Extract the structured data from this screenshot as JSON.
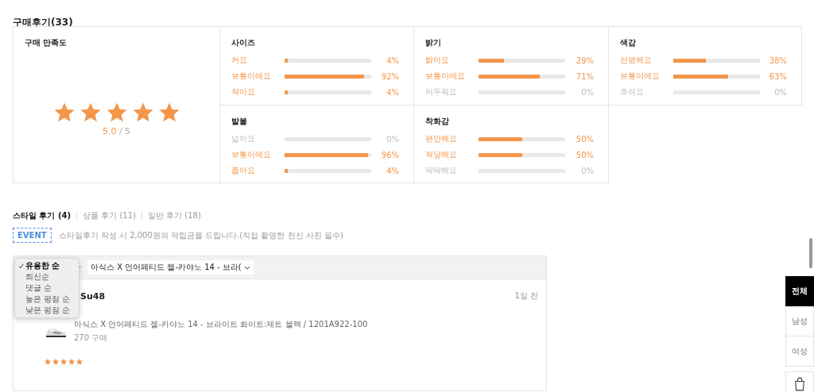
{
  "title": "구매후기(33)",
  "satisfaction": {
    "heading": "구매 만족도",
    "stars": 5,
    "score": "5.0",
    "max": "/ 5"
  },
  "metrics": [
    {
      "heading": "사이즈",
      "options": [
        {
          "label": "커요",
          "level": 0.04,
          "reading": "4%"
        },
        {
          "label": "보통이에요",
          "level": 0.92,
          "reading": "92%"
        },
        {
          "label": "작아요",
          "level": 0.04,
          "reading": "4%"
        }
      ]
    },
    {
      "heading": "밝기",
      "options": [
        {
          "label": "밝아요",
          "level": 0.29,
          "reading": "29%"
        },
        {
          "label": "보통이에요",
          "level": 0.71,
          "reading": "71%"
        },
        {
          "label": "어두워요",
          "level": 0,
          "reading": "0%"
        }
      ]
    },
    {
      "heading": "색감",
      "options": [
        {
          "label": "선명해요",
          "level": 0.38,
          "reading": "38%"
        },
        {
          "label": "보통이에요",
          "level": 0.63,
          "reading": "63%"
        },
        {
          "label": "흐려요",
          "level": 0,
          "reading": "0%"
        }
      ]
    },
    {
      "heading": "발볼",
      "options": [
        {
          "label": "넓어요",
          "level": 0,
          "reading": "0%"
        },
        {
          "label": "보통이에요",
          "level": 0.96,
          "reading": "96%"
        },
        {
          "label": "좁아요",
          "level": 0.04,
          "reading": "4%"
        }
      ]
    },
    {
      "heading": "착화감",
      "options": [
        {
          "label": "편안해요",
          "level": 0.5,
          "reading": "50%"
        },
        {
          "label": "적당해요",
          "level": 0.5,
          "reading": "50%"
        },
        {
          "label": "딱딱해요",
          "level": 0,
          "reading": "0%"
        }
      ]
    }
  ],
  "review_tabs": [
    {
      "label": "스타일 후기 (4)",
      "selected": true
    },
    {
      "label": "상품 후기 (11)",
      "selected": false
    },
    {
      "label": "일반 후기 (18)",
      "selected": false
    }
  ],
  "event": {
    "badge": "EVENT",
    "text": "스타일후기 작성 시 2,000원의 적립금을 드립니다.(직접 촬영한 전신 사진 필수)"
  },
  "sort_menu": [
    {
      "label": "유용한 순",
      "selected": true
    },
    {
      "label": "최신순",
      "selected": false
    },
    {
      "label": "댓글 순",
      "selected": false
    },
    {
      "label": "높은 평점 순",
      "selected": false
    },
    {
      "label": "낮은 평점 순",
      "selected": false
    }
  ],
  "product_filter": {
    "value": "아식스 X 언어페티드 젤-카야노 14 - 브라("
  },
  "review": {
    "user": "Su48",
    "date": "1일 전",
    "product": "아식스 X 언어페티드 젤-카야노 14 - 브라이트 화이트:제트 블랙 / 1201A922-100",
    "purchase": "270  구매",
    "stars": 5
  },
  "gender_tabs": [
    {
      "label": "전체",
      "selected": true
    },
    {
      "label": "남성",
      "selected": false
    },
    {
      "label": "여성",
      "selected": false
    }
  ]
}
